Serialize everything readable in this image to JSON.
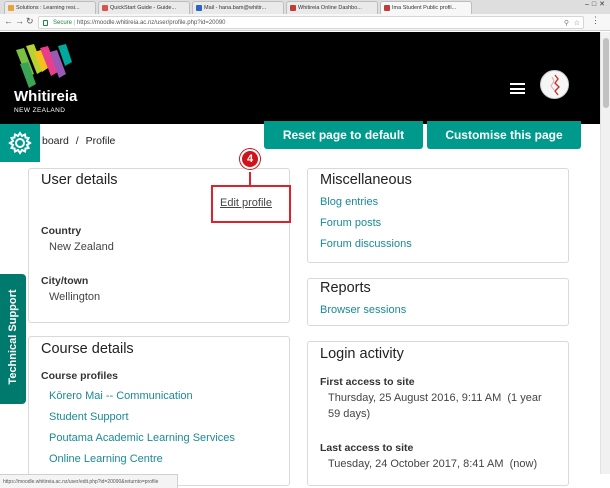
{
  "browser": {
    "tabs": [
      {
        "title": "Solutions : Learning resi...",
        "color": "#e8a33a"
      },
      {
        "title": "QuickStart Guide - Guide...",
        "color": "#d9534f"
      },
      {
        "title": "Mail - hana.bam@whitir...",
        "color": "#2a64c5"
      },
      {
        "title": "Whitireia Online Dashbo...",
        "color": "#c23b3b"
      },
      {
        "title": "Ima Student Public profil...",
        "color": "#c23b3b"
      }
    ],
    "url_secure": "Secure",
    "url": "https://moodle.whitireia.ac.nz/user/profile.php?id=20090",
    "status_url": "https://moodle.whitireia.ac.nz/user/edit.php?id=20090&returnto=profile"
  },
  "header": {
    "logo_name": "Whitireia",
    "logo_sub": "NEW ZEALAND"
  },
  "breadcrumb": {
    "items": [
      "board",
      "Profile"
    ],
    "separator": "/"
  },
  "actions": {
    "reset_label": "Reset page to default",
    "customise_label": "Customise this page"
  },
  "user_details": {
    "title": "User details",
    "edit_link": "Edit profile",
    "step_number": "4",
    "country_label": "Country",
    "country_value": "New Zealand",
    "city_label": "City/town",
    "city_value": "Wellington"
  },
  "course_details": {
    "title": "Course details",
    "profiles_label": "Course profiles",
    "courses": [
      "Kōrero Mai -- Communication",
      "Student Support",
      "Poutama Academic Learning Services",
      "Online Learning Centre"
    ]
  },
  "miscellaneous": {
    "title": "Miscellaneous",
    "links": [
      "Blog entries",
      "Forum posts",
      "Forum discussions"
    ]
  },
  "reports": {
    "title": "Reports",
    "links": [
      "Browser sessions"
    ]
  },
  "login_activity": {
    "title": "Login activity",
    "first_label": "First access to site",
    "first_value_line1": "Thursday, 25 August 2016, 9:11 AM  (1 year",
    "first_value_line2": "59 days)",
    "last_label": "Last access to site",
    "last_value": "Tuesday, 24 October 2017, 8:41 AM  (now)"
  },
  "sidebar_tab": {
    "label": "Technical Support"
  },
  "colors": {
    "accent": "#009a8c",
    "link": "#1a8a96",
    "highlight": "#e0202a"
  }
}
